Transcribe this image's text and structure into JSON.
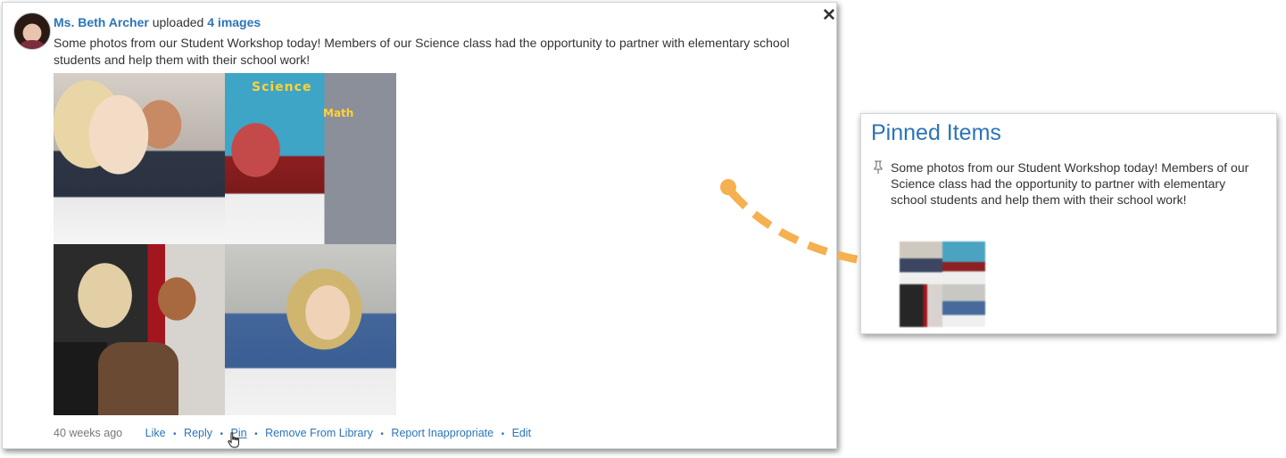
{
  "post": {
    "author": "Ms. Beth Archer",
    "action": "uploaded",
    "images_link": "4 images",
    "close_glyph": "✕",
    "text": "Some photos from our Student Workshop today! Members of our Science class had the opportunity to partner with elementary school students and help them with their school work!",
    "images": [
      {
        "name": "photo-1",
        "sign": ""
      },
      {
        "name": "photo-2",
        "sign": "Science",
        "sign2": "Math"
      },
      {
        "name": "photo-3",
        "sign": ""
      },
      {
        "name": "photo-4",
        "sign": ""
      }
    ],
    "footer": {
      "time": "40 weeks ago",
      "actions": [
        "Like",
        "Reply",
        "Pin",
        "Remove From Library",
        "Report Inappropriate",
        "Edit"
      ],
      "separator": "•"
    }
  },
  "pinned": {
    "title": "Pinned Items",
    "item_text": "Some photos from our Student Workshop today! Members of our Science class had the opportunity to partner with elementary school students and help them with their school work!"
  },
  "colors": {
    "link": "#2b74b8",
    "arrow": "#f5b04f"
  }
}
